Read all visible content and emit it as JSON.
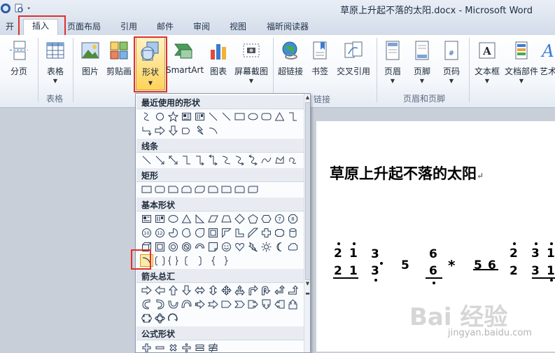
{
  "window": {
    "title": "草原上升起不落的太阳.docx - Microsoft Word"
  },
  "tabs": [
    {
      "label": "开始"
    },
    {
      "label": "插入"
    },
    {
      "label": "页面布局"
    },
    {
      "label": "引用"
    },
    {
      "label": "邮件"
    },
    {
      "label": "审阅"
    },
    {
      "label": "视图"
    },
    {
      "label": "福昕阅读器"
    }
  ],
  "ribbon": {
    "buttons": [
      {
        "label": "分页",
        "icon": "page-break-icon"
      },
      {
        "label": "表格",
        "icon": "table-icon"
      },
      {
        "label": "图片",
        "icon": "picture-icon"
      },
      {
        "label": "剪贴画",
        "icon": "clipart-icon"
      },
      {
        "label": "形状",
        "icon": "shapes-icon"
      },
      {
        "label": "SmartArt",
        "icon": "smartart-icon"
      },
      {
        "label": "图表",
        "icon": "chart-icon"
      },
      {
        "label": "屏幕截图",
        "icon": "screenshot-icon"
      },
      {
        "label": "超链接",
        "icon": "hyperlink-icon"
      },
      {
        "label": "书签",
        "icon": "bookmark-icon"
      },
      {
        "label": "交叉引用",
        "icon": "cross-reference-icon"
      },
      {
        "label": "页眉",
        "icon": "header-icon"
      },
      {
        "label": "页脚",
        "icon": "footer-icon"
      },
      {
        "label": "页码",
        "icon": "page-number-icon"
      },
      {
        "label": "文本框",
        "icon": "text-box-icon"
      },
      {
        "label": "文档部件",
        "icon": "quick-parts-icon"
      },
      {
        "label": "艺术",
        "icon": "wordart-icon"
      }
    ],
    "groups": {
      "tables": "表格",
      "links_partial": "链接",
      "header_footer": "页眉和页脚"
    }
  },
  "shapes_menu": {
    "sections": [
      {
        "title": "最近使用的形状"
      },
      {
        "title": "线条"
      },
      {
        "title": "矩形"
      },
      {
        "title": "基本形状"
      },
      {
        "title": "箭头总汇"
      },
      {
        "title": "公式形状"
      }
    ],
    "selected_shape": "arc-shape"
  },
  "document": {
    "title": "草原上升起不落的太阳",
    "paragraph_mark": "↵",
    "notation": {
      "row1": [
        "2",
        "1",
        "3",
        "6",
        "2",
        "3",
        "1"
      ],
      "row2": [
        "2",
        "1",
        "3",
        "5",
        "6",
        "*",
        "5",
        "6",
        "2",
        "3",
        "1"
      ]
    }
  },
  "watermark": {
    "text": "Bai 经验",
    "url": "jingyan.baidu.com"
  },
  "colors": {
    "highlight": "#e0302b",
    "ribbon_bg": "#f4f7fb",
    "selected_button": "#ffd35a"
  }
}
